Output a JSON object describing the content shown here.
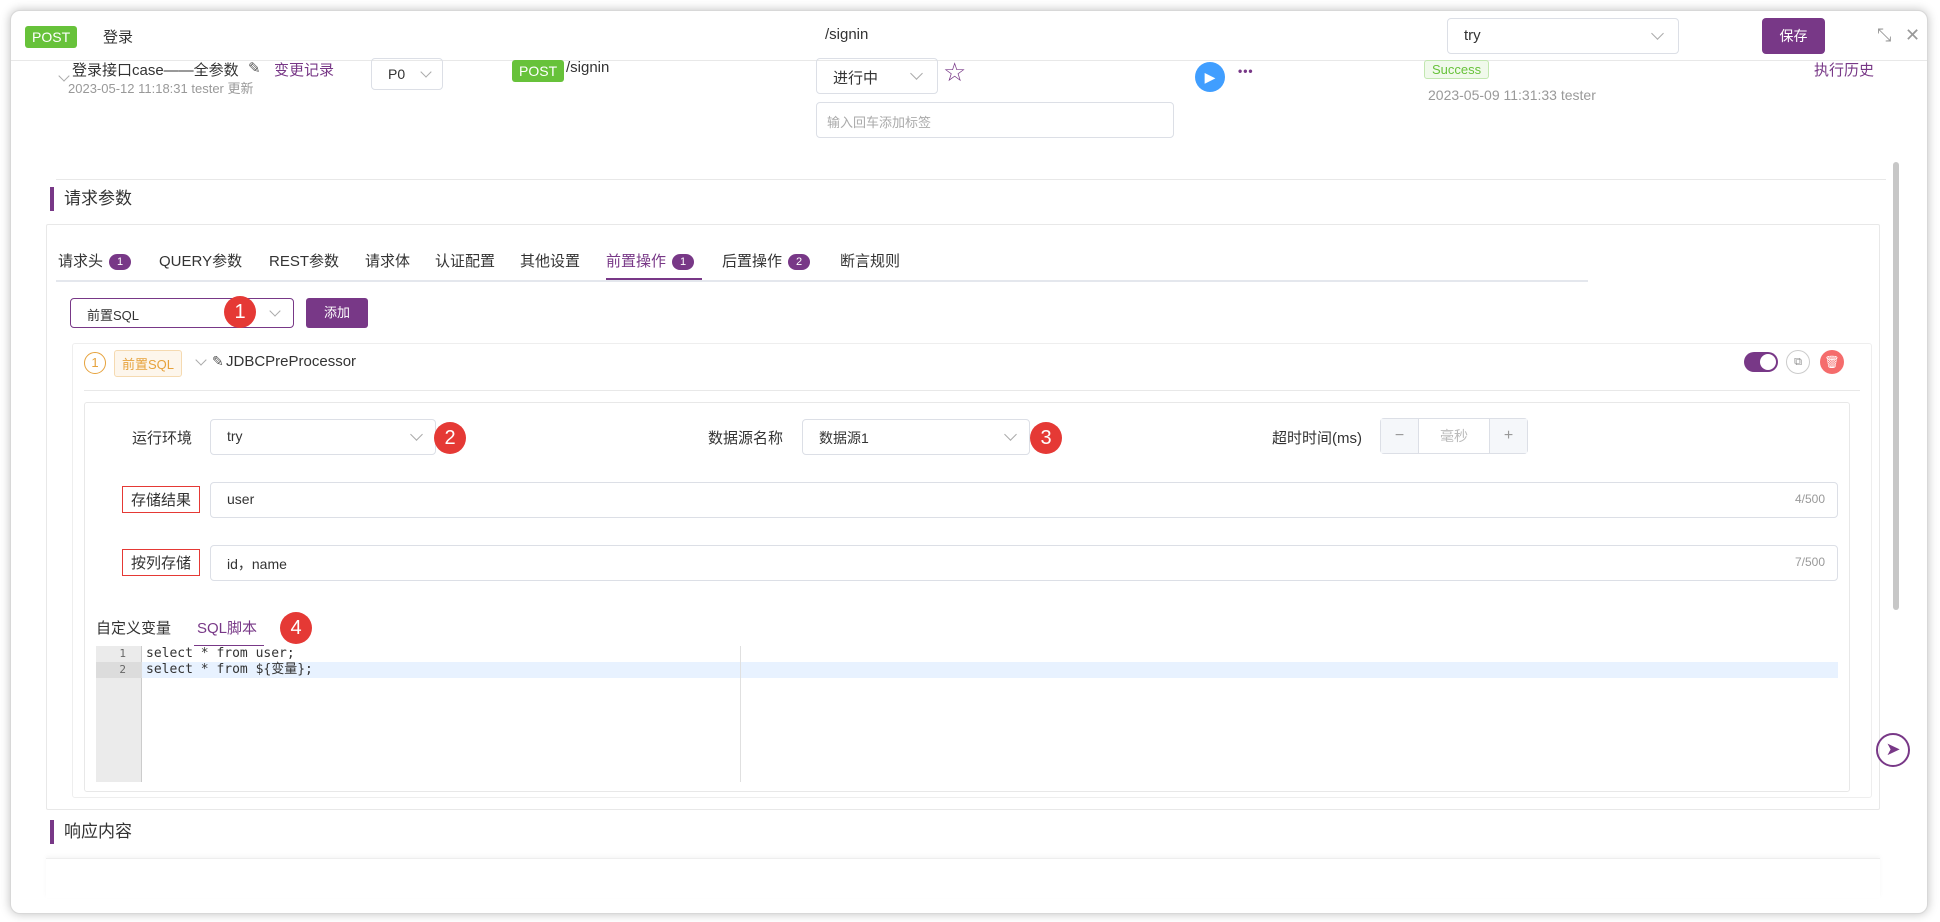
{
  "topbar": {
    "method": "POST",
    "name": "登录",
    "path": "/signin",
    "env": "try",
    "save_label": "保存",
    "minimize_glyph": "⤡",
    "close_glyph": "✕"
  },
  "case": {
    "name": "登录接口case——全参数",
    "edit_glyph": "✎",
    "meta": "2023-05-12 11:18:31 tester 更新",
    "change_log": "变更记录",
    "priority": "P0",
    "method": "POST",
    "path": "/signin",
    "status": "进行中",
    "tag_placeholder": "输入回车添加标签",
    "more_glyph": "•••",
    "result": "Success",
    "result_meta": "2023-05-09 11:31:33 tester",
    "history": "执行历史"
  },
  "request_section_title": "请求参数",
  "tabs": [
    {
      "label": "请求头",
      "badge": "1"
    },
    {
      "label": "QUERY参数"
    },
    {
      "label": "REST参数"
    },
    {
      "label": "请求体"
    },
    {
      "label": "认证配置"
    },
    {
      "label": "其他设置"
    },
    {
      "label": "前置操作",
      "badge": "1",
      "active": true
    },
    {
      "label": "后置操作",
      "badge": "2"
    },
    {
      "label": "断言规则"
    }
  ],
  "pre_ops": {
    "type_select": "前置SQL",
    "add_label": "添加",
    "processor": {
      "index": "1",
      "tag": "前置SQL",
      "name": "JDBCPreProcessor"
    },
    "form": {
      "env_label": "运行环境",
      "env_value": "try",
      "datasource_label": "数据源名称",
      "datasource_value": "数据源1",
      "timeout_label": "超时时间(ms)",
      "timeout_placeholder": "毫秒",
      "store_result_label": "存储结果",
      "store_result_value": "user",
      "store_result_counter": "4/500",
      "store_columns_label": "按列存储",
      "store_columns_value": "id，name",
      "store_columns_counter": "7/500"
    },
    "subtabs": {
      "custom_vars": "自定义变量",
      "sql_script": "SQL脚本"
    },
    "code_lines": [
      {
        "no": "1",
        "text": "select * from user;"
      },
      {
        "no": "2",
        "text": "select * from ${变量};"
      }
    ]
  },
  "annotations": [
    "1",
    "2",
    "3",
    "4"
  ],
  "response_section_title": "响应内容",
  "colors": {
    "accent": "#783887",
    "post_green": "#67c23a",
    "annotation_red": "#e53935",
    "run_blue": "#409eff",
    "warning_orange": "#e6a23c"
  },
  "icons": [
    "star-icon",
    "play-icon",
    "more-icon",
    "copy-icon",
    "delete-icon",
    "compass-icon",
    "chevron-down-icon"
  ]
}
